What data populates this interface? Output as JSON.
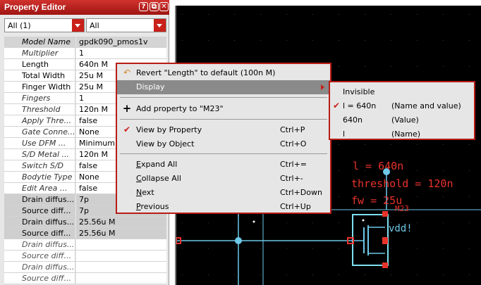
{
  "panel": {
    "title": "Property Editor",
    "buttons": [
      "?",
      "⧉",
      "✕"
    ],
    "filter_left": "All (1)",
    "filter_right": "All"
  },
  "properties": [
    {
      "name": "Model Name",
      "value": "gpdk090_pmos1v",
      "style": "first"
    },
    {
      "name": "Multiplier",
      "value": "1",
      "style": "it"
    },
    {
      "name": "Length",
      "value": "640n M",
      "style": ""
    },
    {
      "name": "Total Width",
      "value": "25u M",
      "style": ""
    },
    {
      "name": "Finger Width",
      "value": "25u M",
      "style": ""
    },
    {
      "name": "Fingers",
      "value": "1",
      "style": "it"
    },
    {
      "name": "Threshold",
      "value": "120n M",
      "style": "it"
    },
    {
      "name": "Apply Thre...",
      "value": "false",
      "style": "it"
    },
    {
      "name": "Gate Conne...",
      "value": "None",
      "style": "it"
    },
    {
      "name": "Use DFM ...",
      "value": "Minimum",
      "style": "it"
    },
    {
      "name": "S/D Metal ...",
      "value": "120n M",
      "style": "it"
    },
    {
      "name": "Switch S/D",
      "value": "false",
      "style": "it"
    },
    {
      "name": "Bodytie Type",
      "value": "None",
      "style": "it"
    },
    {
      "name": "Edit Area ...",
      "value": "false",
      "style": "it"
    },
    {
      "name": "Drain diffus...",
      "value": "7p",
      "style": "ro"
    },
    {
      "name": "Source diff...",
      "value": "7p",
      "style": "ro"
    },
    {
      "name": "Drain diffus...",
      "value": "25.56u M",
      "style": "ro"
    },
    {
      "name": "Source diff...",
      "value": "25.56u M",
      "style": "ro"
    },
    {
      "name": "Drain diffus...",
      "value": "",
      "style": "dim"
    },
    {
      "name": "Source diff...",
      "value": "",
      "style": "dim"
    },
    {
      "name": "Drain diffus...",
      "value": "",
      "style": "dim"
    },
    {
      "name": "Source diff...",
      "value": "",
      "style": "dim"
    }
  ],
  "menu": {
    "revert": "Revert \"Length\" to default (100n M)",
    "display": "Display",
    "add_property": "Add property to \"M23\"",
    "view_by_property": "View by Property",
    "view_by_property_sc": "Ctrl+P",
    "view_by_object": "View by Object",
    "view_by_object_sc": "Ctrl+O",
    "expand_all_u": "E",
    "expand_all_rest": "xpand All",
    "expand_all_sc": "Ctrl+=",
    "collapse_all_u": "C",
    "collapse_all_rest": "ollapse All",
    "collapse_all_sc": "Ctrl+-",
    "next_u": "N",
    "next_rest": "ext",
    "next_sc": "Ctrl+Down",
    "previous_u": "P",
    "previous_rest": "revious",
    "previous_sc": "Ctrl+Up"
  },
  "submenu": [
    {
      "label": "Invisible",
      "desc": "",
      "checked": false
    },
    {
      "label": "l = 640n",
      "desc": "(Name and value)",
      "checked": true
    },
    {
      "label": "640n",
      "desc": "(Value)",
      "checked": false
    },
    {
      "label": "l",
      "desc": "(Name)",
      "checked": false
    }
  ],
  "canvas": {
    "label_length": "l = 640n",
    "label_threshold": "threshold = 120n",
    "label_fw": "fw = 25u",
    "label_instance": "M23",
    "label_vdd": "vdd!"
  },
  "colors": {
    "accent": "#c9201a",
    "wire": "#6ec8e8",
    "instance_text": "#e8332b"
  }
}
